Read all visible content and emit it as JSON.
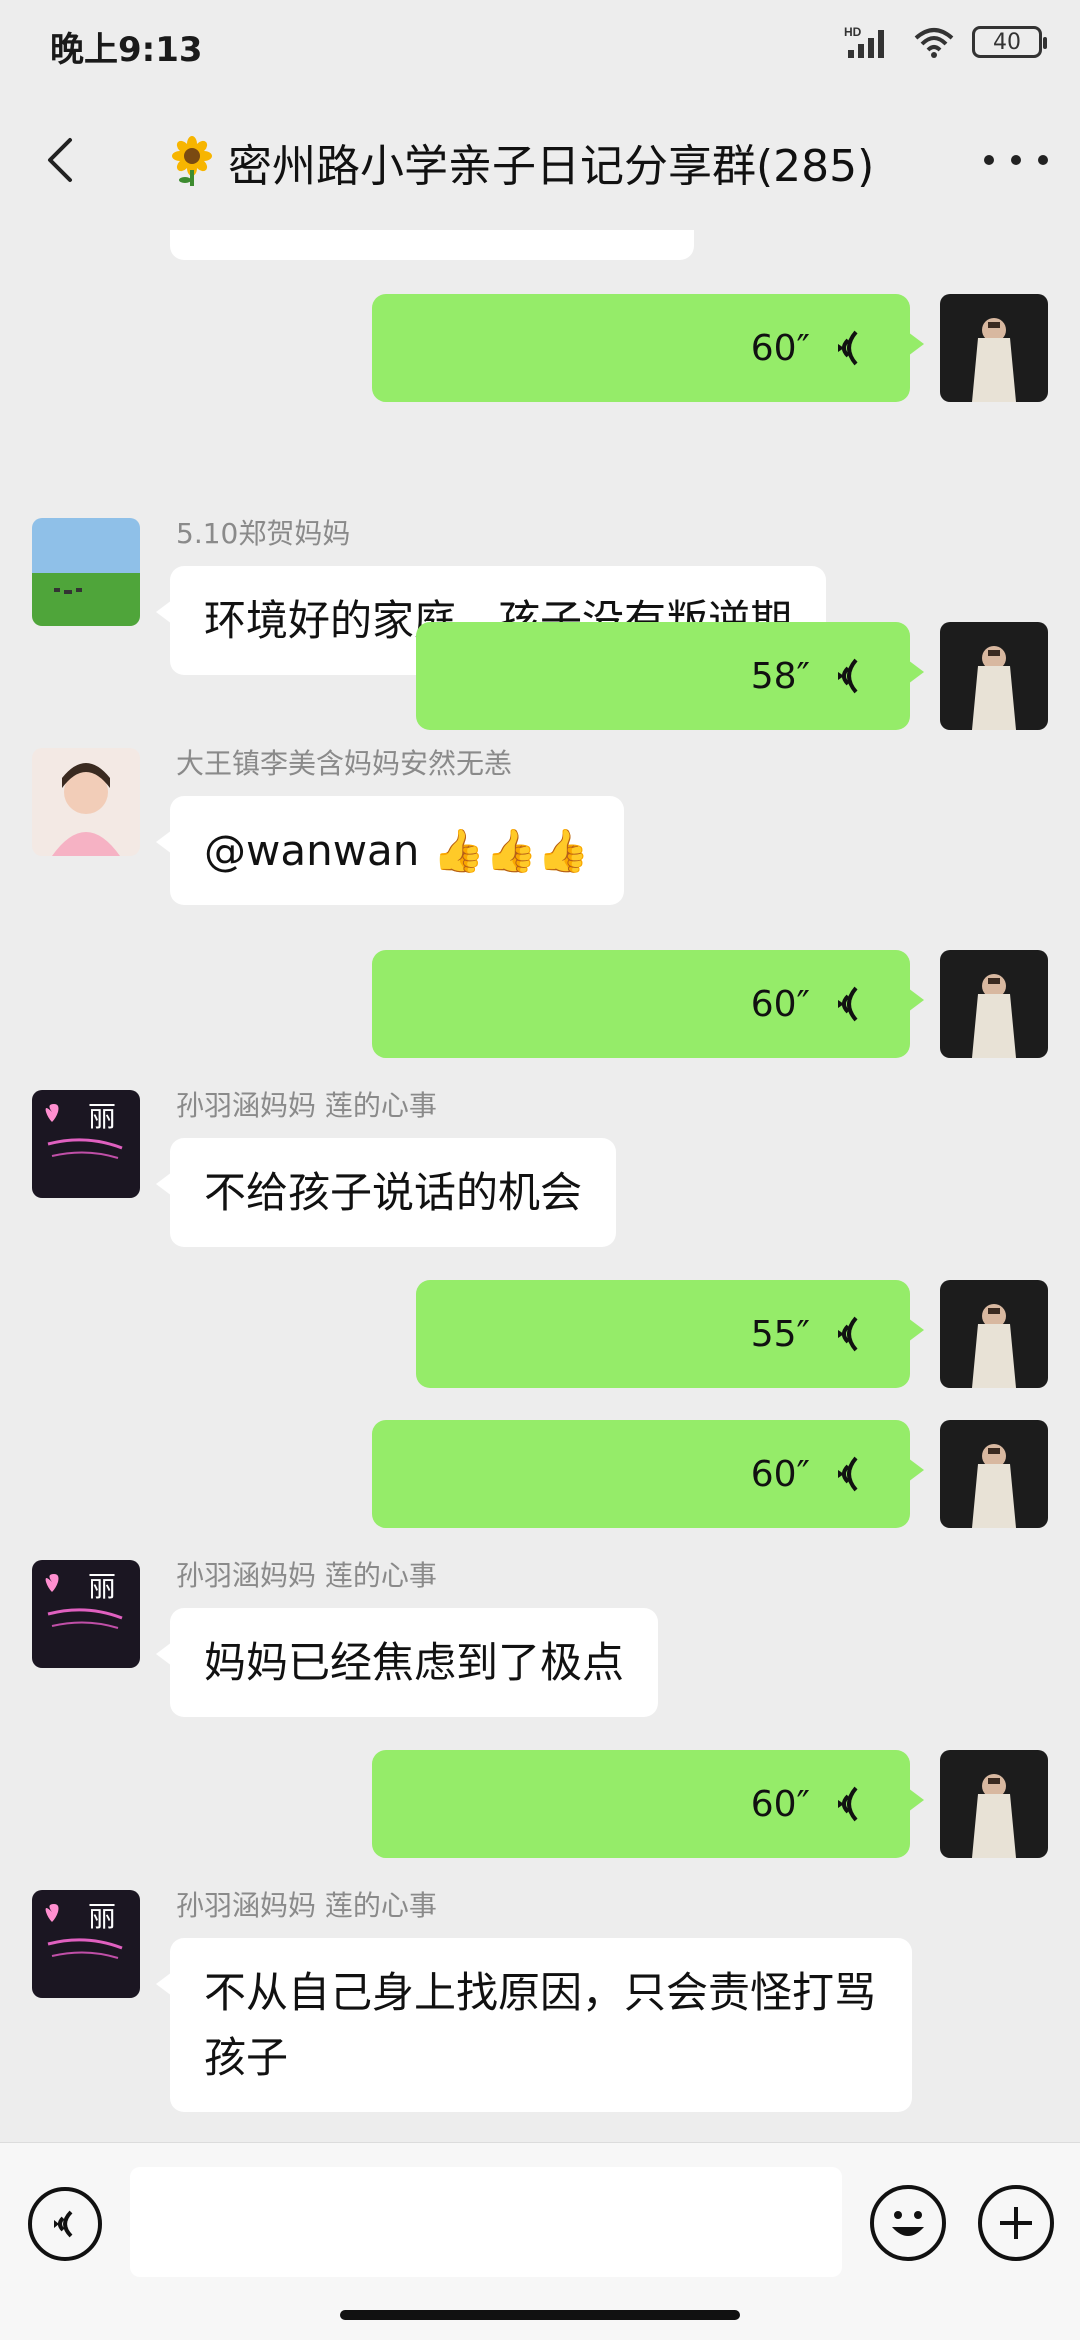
{
  "status_bar": {
    "time": "晚上9:13",
    "signal_label": "HD",
    "battery": "40"
  },
  "nav": {
    "title": "密州路小学亲子日记分享群(285)"
  },
  "messages": [
    {
      "type": "voice",
      "duration": "60″"
    },
    {
      "type": "text",
      "sender": "5.10郑贺妈妈",
      "text": "环境好的家庭，孩子没有叛逆期"
    },
    {
      "type": "voice",
      "duration": "58″"
    },
    {
      "type": "text",
      "sender": "大王镇李美含妈妈安然无恙",
      "text": "@wanwan 👍👍👍"
    },
    {
      "type": "voice",
      "duration": "60″"
    },
    {
      "type": "text",
      "sender": "孙羽涵妈妈  莲的心事",
      "text": "不给孩子说话的机会"
    },
    {
      "type": "voice",
      "duration": "55″"
    },
    {
      "type": "voice",
      "duration": "60″"
    },
    {
      "type": "text",
      "sender": "孙羽涵妈妈  莲的心事",
      "text": "妈妈已经焦虑到了极点"
    },
    {
      "type": "voice",
      "duration": "60″"
    },
    {
      "type": "text",
      "sender": "孙羽涵妈妈  莲的心事",
      "text": "不从自己身上找原因，只会责怪打骂孩子"
    }
  ],
  "avatars": {
    "lotus_text": "丽"
  },
  "colors": {
    "my_bubble": "#95ec69",
    "other_bubble": "#ffffff",
    "background": "#ededed"
  }
}
